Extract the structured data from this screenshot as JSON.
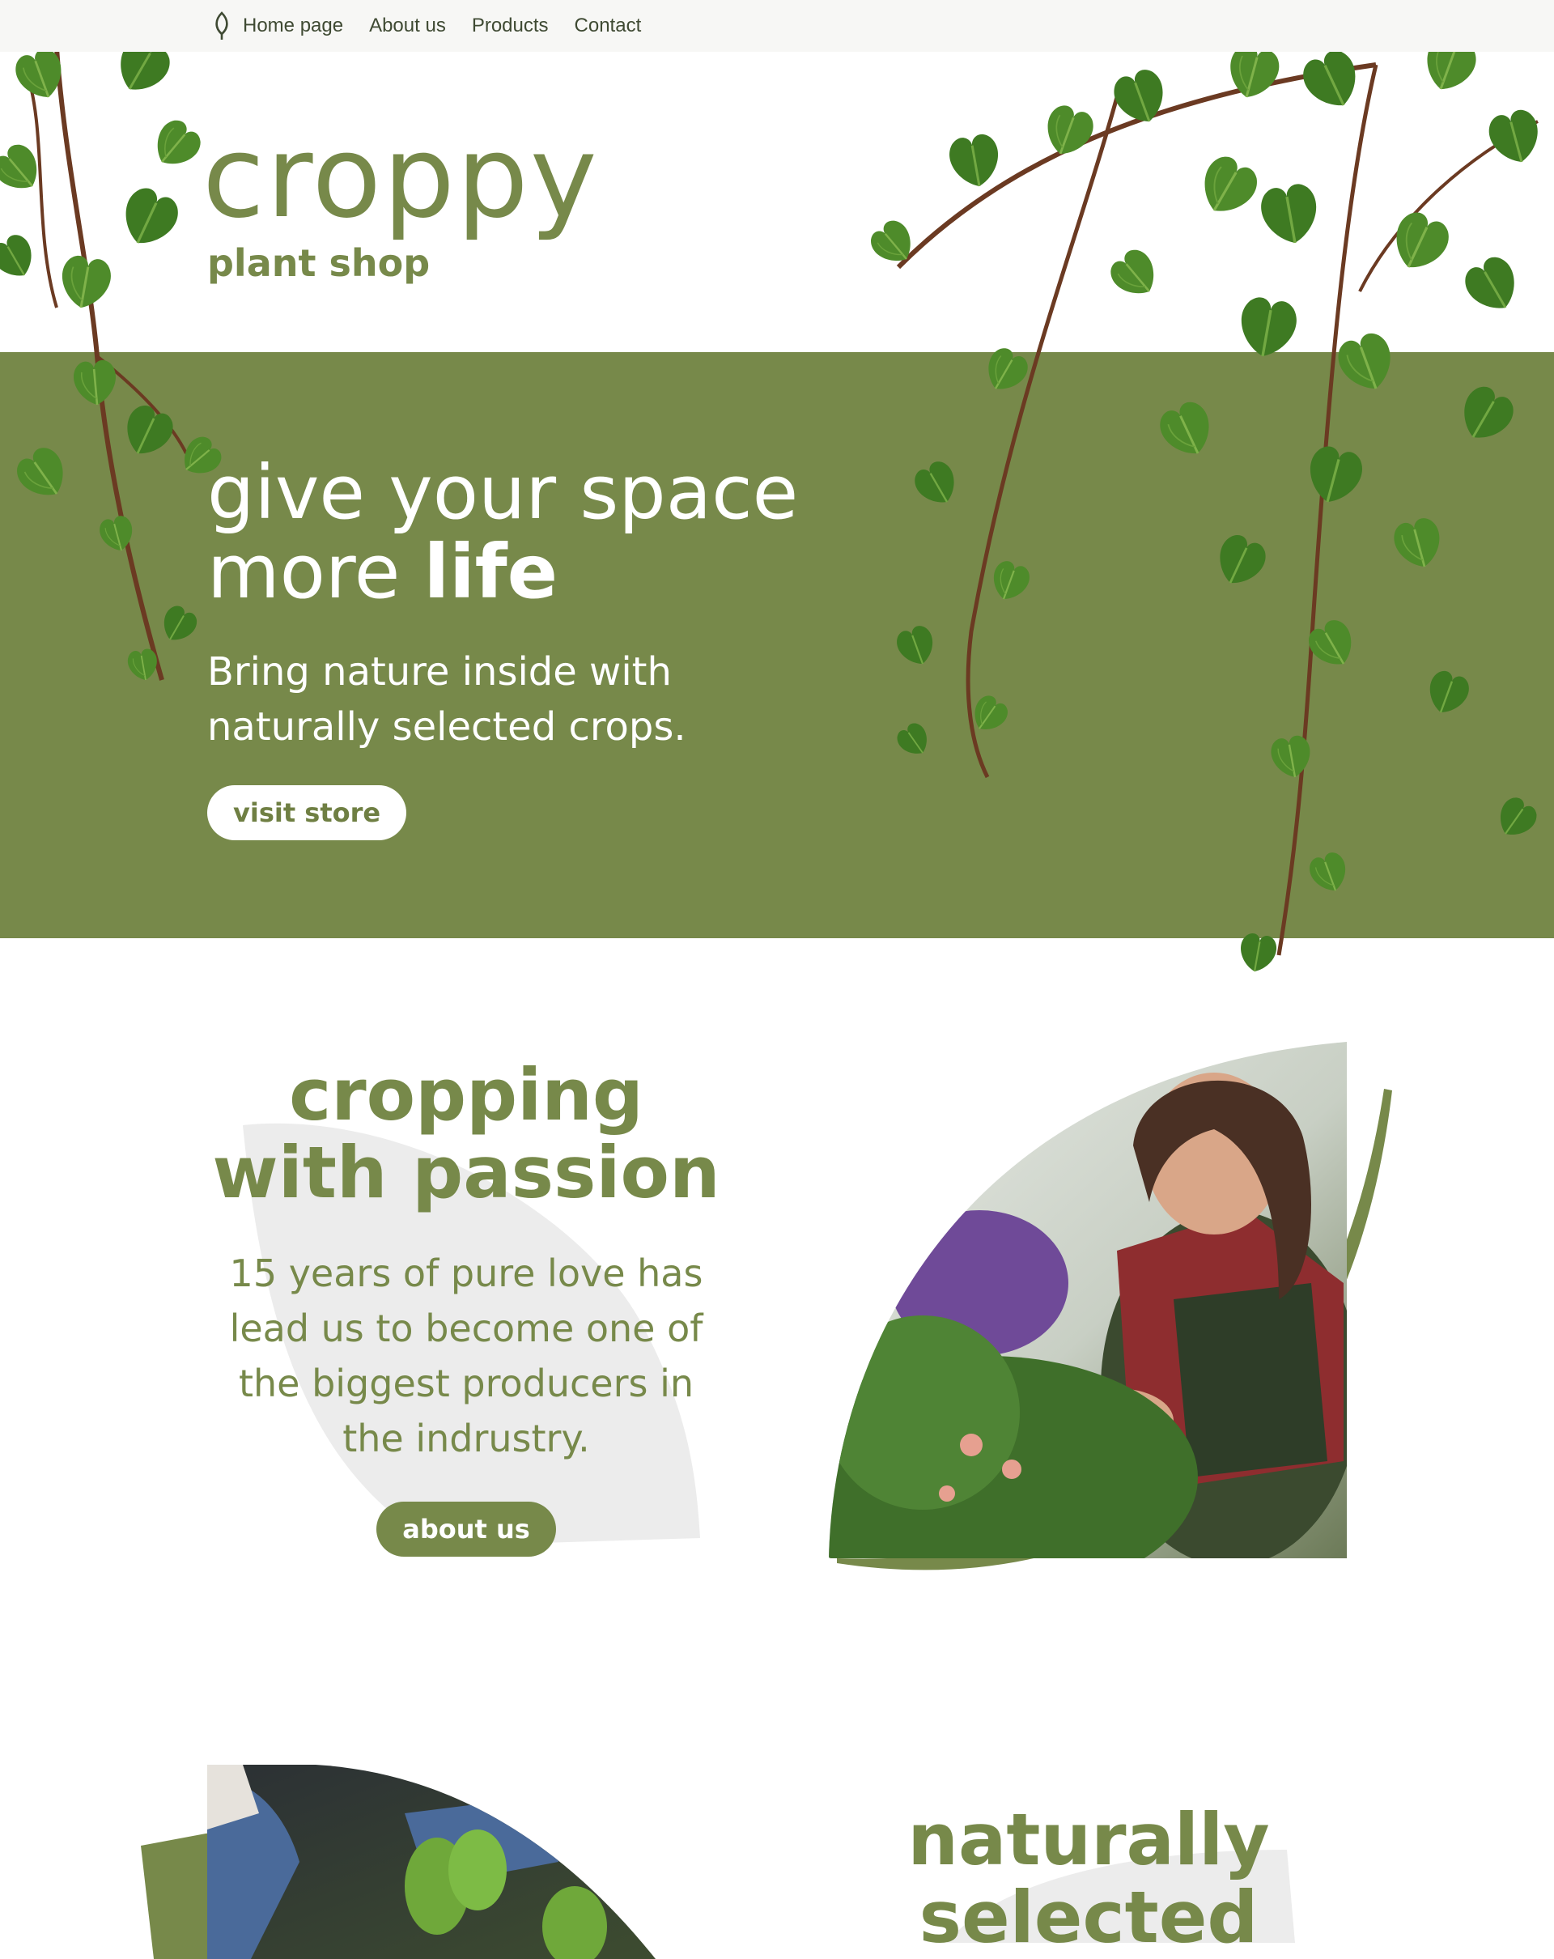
{
  "nav": {
    "logo_icon": "leaf-icon",
    "items": [
      "Home page",
      "About us",
      "Products",
      "Contact"
    ]
  },
  "brand": {
    "name": "croppy",
    "tagline": "plant shop"
  },
  "hero": {
    "title_line1": "give your space",
    "title_line2_regular": "more ",
    "title_line2_bold": "life",
    "subtitle_line1": "Bring nature inside with",
    "subtitle_line2": "naturally selected crops.",
    "cta": "visit store"
  },
  "passion": {
    "title_line1": "cropping",
    "title_line2": "with passion",
    "body_lines": [
      "15 years of pure love has",
      "lead us to become one of",
      "the biggest producers in",
      "the indrustry."
    ],
    "cta": "about us"
  },
  "naturally": {
    "title_line1": "naturally",
    "title_line2": "selected"
  },
  "colors": {
    "brand_green": "#77894a",
    "leaf_green": "#4f8a2b",
    "vine_brown": "#6b3a22",
    "grey_shape": "#ececec",
    "nav_bg": "#f7f7f5"
  }
}
